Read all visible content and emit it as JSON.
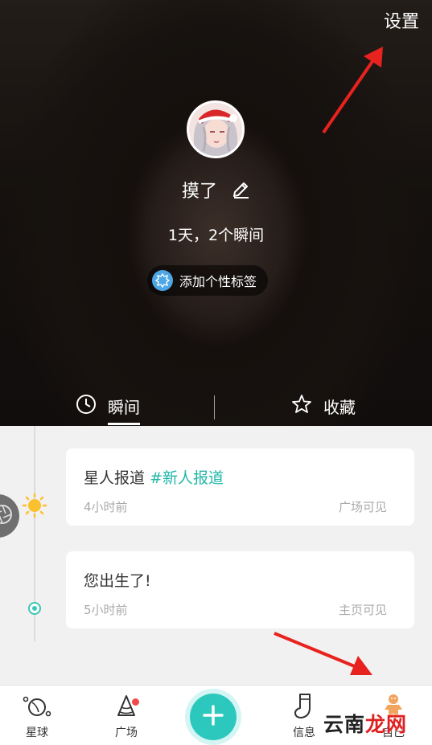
{
  "header": {
    "settings_label": "设置",
    "username": "摸了",
    "stats": "1天，2个瞬间",
    "add_tag_label": "添加个性标签"
  },
  "tabs": [
    {
      "label": "瞬间",
      "icon": "clock-icon",
      "active": true
    },
    {
      "label": "收藏",
      "icon": "star-outline-icon",
      "active": false
    }
  ],
  "moments": [
    {
      "title": "星人报道",
      "hashtag": "#新人报道",
      "time": "4小时前",
      "visibility": "广场可见",
      "node_icon": "sun-icon"
    },
    {
      "title": "您出生了!",
      "hashtag": "",
      "time": "5小时前",
      "visibility": "主页可见",
      "node_icon": "dot-icon"
    }
  ],
  "bottom_nav": [
    {
      "label": "星球",
      "icon": "planet-icon"
    },
    {
      "label": "广场",
      "icon": "cone-icon",
      "badge": true
    },
    {
      "label": "",
      "icon": "plus-icon"
    },
    {
      "label": "信息",
      "icon": "sock-icon"
    },
    {
      "label": "自己",
      "icon": "gingerbread-icon"
    }
  ],
  "watermark": {
    "part1": "云南",
    "part2": "龙网"
  },
  "colors": {
    "accent": "#2dc8bd",
    "hashtag": "#21b7a8",
    "badge": "#f24a4a",
    "annotation_arrow": "#e8221e"
  }
}
